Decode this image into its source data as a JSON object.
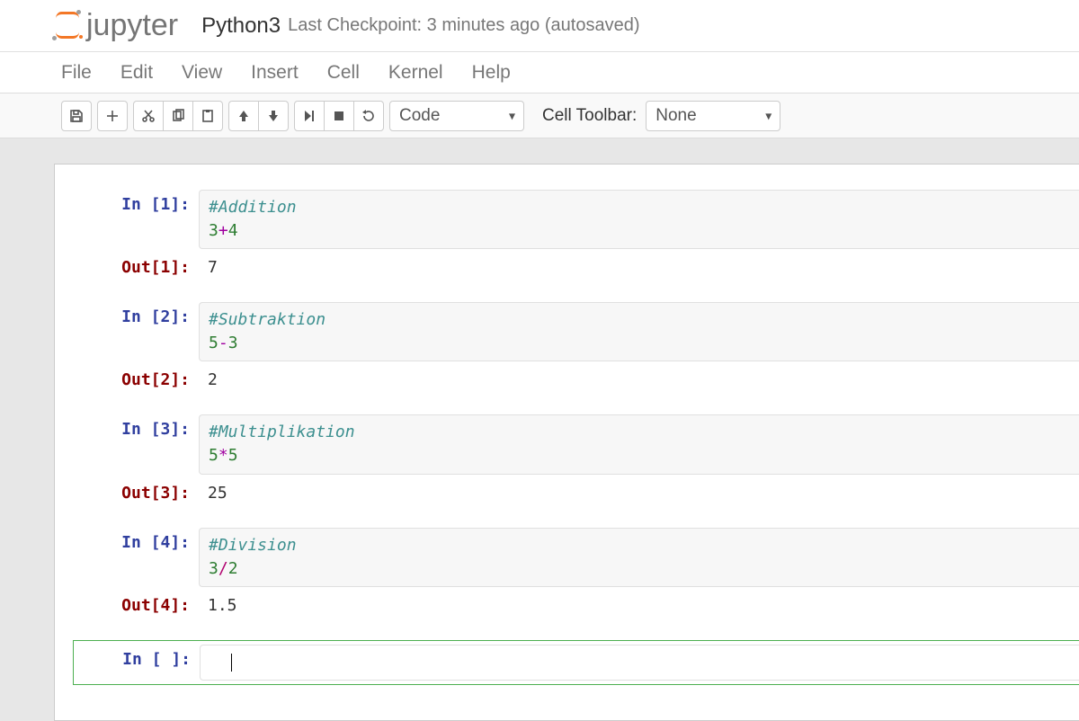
{
  "header": {
    "logo_text": "jupyter",
    "notebook_name": "Python3",
    "checkpoint_text": "Last Checkpoint: 3 minutes ago (autosaved)"
  },
  "menubar": {
    "items": [
      "File",
      "Edit",
      "View",
      "Insert",
      "Cell",
      "Kernel",
      "Help"
    ]
  },
  "toolbar": {
    "cell_type_selected": "Code",
    "cell_toolbar_label": "Cell Toolbar:",
    "cell_toolbar_selected": "None"
  },
  "cells": [
    {
      "in_prompt": "In [1]:",
      "code_lines": [
        {
          "tokens": [
            {
              "cls": "tok-comment",
              "t": "#Addition"
            }
          ]
        },
        {
          "tokens": [
            {
              "cls": "tok-num",
              "t": "3"
            },
            {
              "cls": "tok-punct",
              "t": "+"
            },
            {
              "cls": "tok-num",
              "t": "4"
            }
          ]
        }
      ],
      "out_prompt": "Out[1]:",
      "out_text": "7"
    },
    {
      "in_prompt": "In [2]:",
      "code_lines": [
        {
          "tokens": [
            {
              "cls": "tok-comment",
              "t": "#Subtraktion"
            }
          ]
        },
        {
          "tokens": [
            {
              "cls": "tok-num",
              "t": "5"
            },
            {
              "cls": "tok-punct",
              "t": "-"
            },
            {
              "cls": "tok-num",
              "t": "3"
            }
          ]
        }
      ],
      "out_prompt": "Out[2]:",
      "out_text": "2"
    },
    {
      "in_prompt": "In [3]:",
      "code_lines": [
        {
          "tokens": [
            {
              "cls": "tok-comment",
              "t": "#Multiplikation"
            }
          ]
        },
        {
          "tokens": [
            {
              "cls": "tok-num",
              "t": "5"
            },
            {
              "cls": "tok-punct",
              "t": "*"
            },
            {
              "cls": "tok-num",
              "t": "5"
            }
          ]
        }
      ],
      "out_prompt": "Out[3]:",
      "out_text": "25"
    },
    {
      "in_prompt": "In [4]:",
      "code_lines": [
        {
          "tokens": [
            {
              "cls": "tok-comment",
              "t": "#Division"
            }
          ]
        },
        {
          "tokens": [
            {
              "cls": "tok-num",
              "t": "3"
            },
            {
              "cls": "tok-punct2",
              "t": "/"
            },
            {
              "cls": "tok-num",
              "t": "2"
            }
          ]
        }
      ],
      "out_prompt": "Out[4]:",
      "out_text": "1.5"
    }
  ],
  "empty_cell": {
    "in_prompt": "In [ ]:"
  }
}
